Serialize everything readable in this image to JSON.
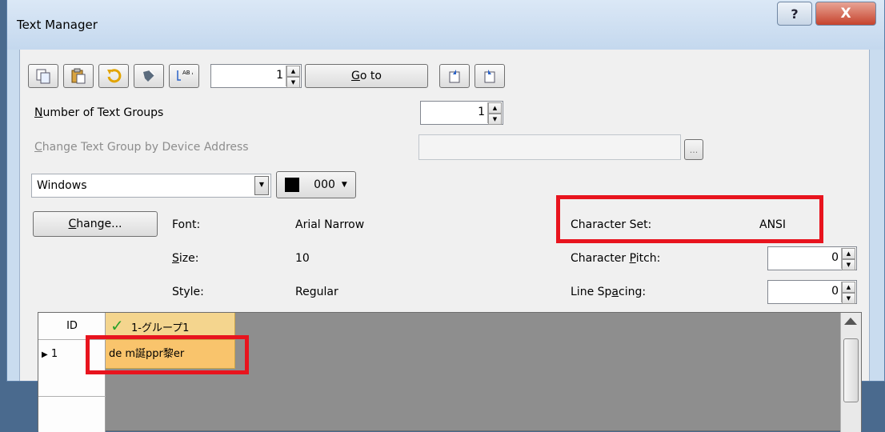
{
  "window": {
    "title": "Text Manager",
    "help_glyph": "?",
    "close_glyph": "X"
  },
  "toolbar": {
    "icons": [
      "copy-icon",
      "paste-icon",
      "undo-icon",
      "import-icon",
      "replace-text-icon",
      "export-icon",
      "import-file-icon"
    ],
    "replace_icon_text": "AB AC",
    "goto_value": "1",
    "goto_label": "Go to",
    "goto_mnemonic": "G",
    "goto_rest": "o to"
  },
  "groups": {
    "label_mn": "N",
    "label_rest": "umber of Text Groups",
    "value": "1"
  },
  "device": {
    "label_mn": "C",
    "label_rest": "hange Text Group by Device Address",
    "value": "",
    "browse": "..."
  },
  "font_select": {
    "value": "Windows",
    "color_code": "000",
    "color_hex": "#000000"
  },
  "change_button": {
    "mn": "C",
    "rest": "hange..."
  },
  "font_info": {
    "font_label": "Font:",
    "font_value": "Arial Narrow",
    "size_mn": "S",
    "size_rest": "ize:",
    "size_value": "10",
    "style_label": "Style:",
    "style_value": "Regular",
    "charset_label": "Character Set:",
    "charset_value": "ANSI",
    "pitch_pre": "Character ",
    "pitch_mn": "P",
    "pitch_rest": "itch:",
    "pitch_value": "0",
    "spacing_pre": "Line Sp",
    "spacing_mn": "a",
    "spacing_rest": "cing:",
    "spacing_value": "0"
  },
  "table": {
    "id_header": "ID",
    "group_header": "1-グループ1",
    "row_indicator": "▶",
    "row_id": "1",
    "row_text": "de m誕ppr黎er"
  },
  "colors": {
    "highlight": "#e8141e",
    "selected_cell": "#f9c46c",
    "grid_bg": "#8e8e8e"
  }
}
